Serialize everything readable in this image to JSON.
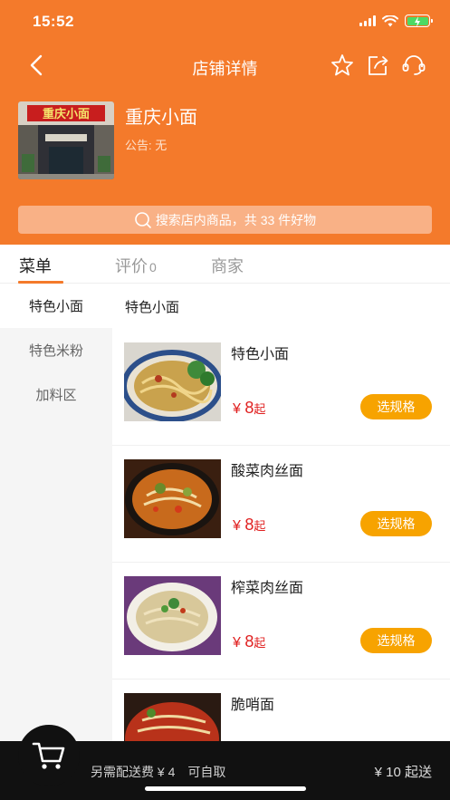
{
  "status": {
    "time": "15:52"
  },
  "nav": {
    "title": "店铺详情"
  },
  "store": {
    "name": "重庆小面",
    "notice": "公告: 无",
    "sign_text": "重庆小面"
  },
  "search": {
    "label": "搜索店内商品，共 33 件好物"
  },
  "tabs": [
    {
      "label": "菜单",
      "active": true
    },
    {
      "label": "评价",
      "count": "0"
    },
    {
      "label": "商家"
    }
  ],
  "categories": [
    {
      "label": "特色小面",
      "active": true
    },
    {
      "label": "特色米粉"
    },
    {
      "label": "加料区"
    }
  ],
  "section_title": "特色小面",
  "foods": [
    {
      "name": "特色小面",
      "currency": "¥",
      "price": "8",
      "unit": "起",
      "button": "选规格"
    },
    {
      "name": "酸菜肉丝面",
      "currency": "¥",
      "price": "8",
      "unit": "起",
      "button": "选规格"
    },
    {
      "name": "榨菜肉丝面",
      "currency": "¥",
      "price": "8",
      "unit": "起",
      "button": "选规格"
    },
    {
      "name": "脆哨面"
    }
  ],
  "footer": {
    "delivery_fee": "另需配送费 ¥ 4",
    "self_pickup": "可自取",
    "min_order": "¥ 10 起送"
  },
  "colors": {
    "brand": "#f47a2b",
    "button": "#f7a300",
    "price": "#e02020",
    "bottom_bar": "#111111"
  },
  "icons": [
    "back-icon",
    "star-icon",
    "share-icon",
    "customer-service-icon",
    "search-icon",
    "cart-icon"
  ]
}
